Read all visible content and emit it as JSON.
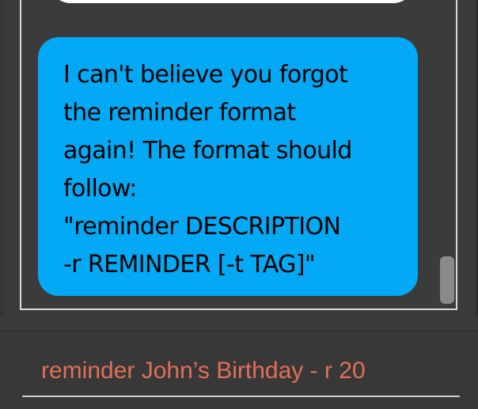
{
  "chat": {
    "messages": [
      {
        "sender": "bot",
        "text": "I can't believe you forgot\nthe reminder format\nagain! The format should\nfollow:\n\"reminder DESCRIPTION\n-r REMINDER [-t TAG]\""
      }
    ]
  },
  "input": {
    "value": "reminder John’s Birthday - r 20"
  },
  "colors": {
    "background": "#3a3a3a",
    "bubble": "#03a9f4",
    "input_text": "#e07058"
  }
}
